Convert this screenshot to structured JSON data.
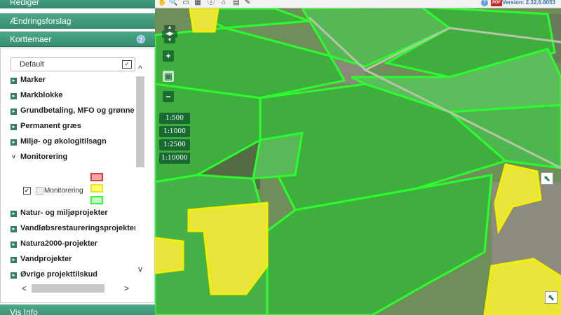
{
  "panel": {
    "headers": {
      "rediger": "Rediger",
      "aendringsforslag": "Ændringsforslag",
      "korttemaer": "Korttemaer",
      "vis_info": "Vis Info"
    },
    "help_icon": "?",
    "theme_select": {
      "value": "Default",
      "arrow": "✓"
    },
    "layers": [
      {
        "label": "Marker"
      },
      {
        "label": "Markblokke"
      },
      {
        "label": "Grundbetaling, MFO og grønne"
      },
      {
        "label": "Permanent græs"
      },
      {
        "label": "Miljø- og økologitilsagn"
      },
      {
        "label": "Monitorering",
        "expanded": true
      },
      {
        "label": "Natur- og miljøprojekter"
      },
      {
        "label": "Vandløbsrestaureringsprojekter"
      },
      {
        "label": "Natura2000-projekter"
      },
      {
        "label": "Vandprojekter"
      },
      {
        "label": "Øvrige projekttilskud"
      }
    ],
    "legend": {
      "label": "Monitorering",
      "checked_mark": "✓",
      "colors": {
        "red": "#e53935",
        "yellow": "#ffff33",
        "green": "#33ff33"
      }
    },
    "scroll": {
      "up": "^",
      "down": "v",
      "left": "<",
      "right": ">"
    }
  },
  "toolbar": {
    "tools": [
      "hand-icon",
      "zoom-icon",
      "print-icon",
      "save-icon",
      "info-icon",
      "home-icon",
      "measure-icon",
      "link-icon"
    ],
    "help": "?",
    "pdf": "PDF",
    "version": "Version: 2.32.6.8053"
  },
  "map_controls": {
    "zoom_in": "+",
    "zoom_out": "−",
    "scales": [
      "1:500",
      "1:1000",
      "1:2500",
      "1:10000"
    ]
  },
  "colors": {
    "accent": "#348f70",
    "field_green": "#3fae3f",
    "field_border": "#2bff2b",
    "field_yellow": "#e8e43a",
    "yellow_border": "#f3f000"
  }
}
